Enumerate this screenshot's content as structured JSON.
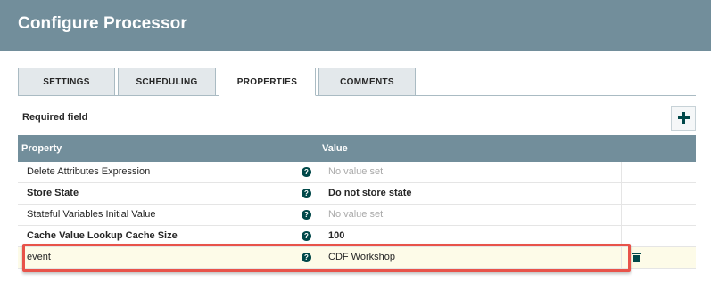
{
  "dialog": {
    "title": "Configure Processor"
  },
  "tabs": [
    {
      "label": "SETTINGS",
      "active": false
    },
    {
      "label": "SCHEDULING",
      "active": false
    },
    {
      "label": "PROPERTIES",
      "active": true
    },
    {
      "label": "COMMENTS",
      "active": false
    }
  ],
  "required_field_label": "Required field",
  "add_property_icon": "plus-icon",
  "table": {
    "headers": {
      "property": "Property",
      "value": "Value"
    },
    "rows": [
      {
        "property": "Delete Attributes Expression",
        "value": "No value set",
        "required": false,
        "has_value": false,
        "help_icon": "question-circle-icon"
      },
      {
        "property": "Store State",
        "value": "Do not store state",
        "required": true,
        "has_value": true,
        "help_icon": "question-circle-icon"
      },
      {
        "property": "Stateful Variables Initial Value",
        "value": "No value set",
        "required": false,
        "has_value": false,
        "help_icon": "question-circle-icon"
      },
      {
        "property": "Cache Value Lookup Cache Size",
        "value": "100",
        "required": true,
        "has_value": true,
        "help_icon": "question-circle-icon"
      },
      {
        "property": "event",
        "value": "CDF Workshop",
        "required": false,
        "has_value": true,
        "help_icon": "question-circle-icon",
        "delete_icon": "trash-icon",
        "highlighted": true
      }
    ]
  },
  "help_glyph": "?",
  "colors": {
    "header_bg": "#728e9b",
    "accent": "#004849",
    "highlight_row": "#fdfbe8",
    "annotation_box": "#e8534a"
  }
}
